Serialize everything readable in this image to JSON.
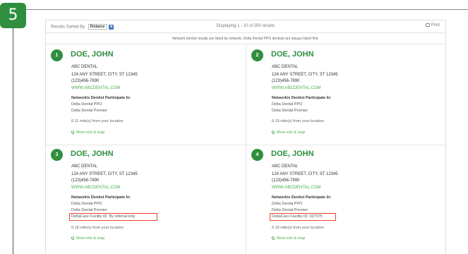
{
  "step": {
    "number": "5"
  },
  "controls": {
    "sorted_by_label": "Results Sorted By",
    "sort_value": "Distance",
    "sort_arrow": "▼",
    "displaying": "Displaying 1 - 10 of 250 results",
    "print_label": "Print",
    "print_icon": "printer-icon"
  },
  "network_note": "Network dentist results are listed by network. Delta Dental PPO dentists are always listed first.",
  "results": [
    {
      "index": "1",
      "name": "DOE, JOHN",
      "practice": "ABC DENTAL",
      "address": "124 ANY STREET, CITY, ST 12345",
      "phone": "(123)456-7890",
      "website": "WWW.ABCDENTAL.COM",
      "networks_heading": "Network/s Dentist Participate In:",
      "networks": [
        "Delta Dental PPO",
        "Delta Dental Premier"
      ],
      "distance": "0.11 mile(s) from your location",
      "more": "More info & map"
    },
    {
      "index": "2",
      "name": "DOE, JOHN",
      "practice": "ABC DENTAL",
      "address": "124 ANY STREET, CITY, ST 12345",
      "phone": "(123)456-7890",
      "website": "WWW.ABCDENTAL.COM",
      "networks_heading": "Network/s Dentist Participate In:",
      "networks": [
        "Delta Dental PPO",
        "Delta Dental Premier"
      ],
      "distance": "0.19 mile(s) from your location",
      "more": "More info & map"
    },
    {
      "index": "3",
      "name": "DOE, JOHN",
      "practice": "ABC DENTAL",
      "address": "124 ANY STREET, CITY, ST 12345",
      "phone": "(123)456-7890",
      "website": "WWW.ABCDENTAL.COM",
      "networks_heading": "Network/s Dentist Participate In:",
      "networks": [
        "Delta Dental PPO",
        "Delta Dental Premier",
        "DeltaCare Facility ID: By referral only"
      ],
      "distance": "0.19 mile(s) from your location",
      "more": "More info & map"
    },
    {
      "index": "4",
      "name": "DOE, JOHN",
      "practice": "ABC DENTAL",
      "address": "124 ANY STREET, CITY, ST 12345",
      "phone": "(123)456-7890",
      "website": "WWW.ABCDENTAL.COM",
      "networks_heading": "Network/s Dentist Participate In:",
      "networks": [
        "Delta Dental PPO",
        "Delta Dental Premier",
        "DeltaCare Facility ID: 027375"
      ],
      "distance": "0.19 mile(s) from your location",
      "more": "More info & map"
    }
  ],
  "colors": {
    "brand_green": "#2f8f3f",
    "link_green": "#4caf50",
    "highlight_red": "#e8482f"
  }
}
